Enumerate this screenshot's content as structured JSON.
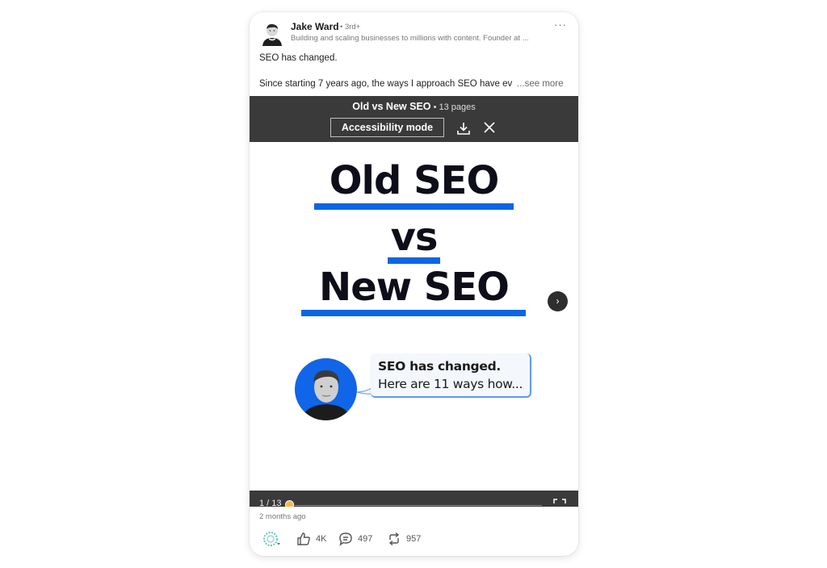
{
  "post": {
    "author": "Jake Ward",
    "degree": "• 3rd+",
    "headline": "Building and scaling businesses to millions with content. Founder at ...",
    "more_menu": "···",
    "text_line1": "SEO has changed.",
    "text_line2": "Since starting 7 years ago, the ways I approach SEO have ev",
    "see_more": "...see more",
    "timestamp": "2 months ago"
  },
  "document": {
    "title": "Old vs New SEO",
    "separator": " • ",
    "pages_label": "13 pages",
    "accessibility_button": "Accessibility mode",
    "download_icon": "download-icon",
    "close_icon": "close-icon",
    "slide": {
      "line1": "Old SEO",
      "line2": "vs",
      "line3": "New SEO",
      "bubble_line1": "SEO has changed.",
      "bubble_line2": "Here are 11 ways how...",
      "accent_color": "#0a66e4"
    },
    "next_label": "›",
    "page_indicator": "1 / 13",
    "current_page": 1,
    "total_pages": 13,
    "progress_fraction": 0.077
  },
  "actions": {
    "reaction_icon": "reaction-picker-icon",
    "likes": "4K",
    "comments": "497",
    "reposts": "957"
  }
}
